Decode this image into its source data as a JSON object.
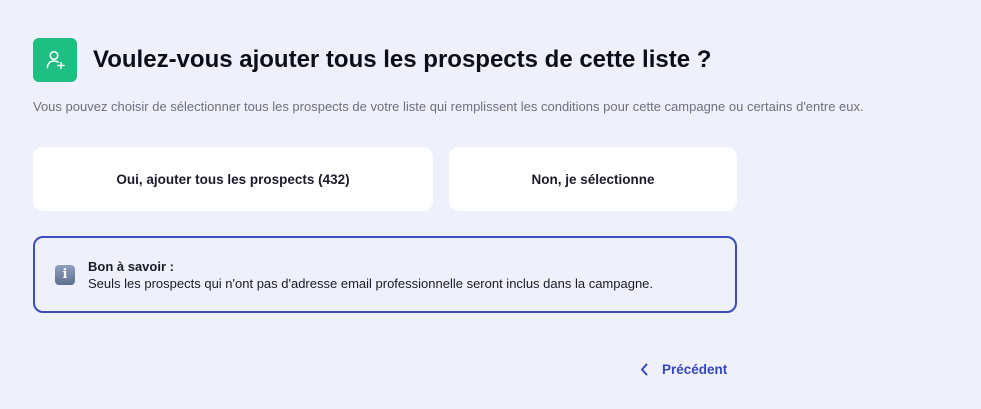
{
  "header": {
    "icon": "user-add-icon",
    "icon_bg": "#1fbf84",
    "title": "Voulez-vous ajouter tous les prospects de cette liste ?"
  },
  "subtitle": "Vous pouvez choisir de sélectionner tous les prospects de votre liste qui remplissent les conditions pour cette campagne ou certains d'entre eux.",
  "choices": {
    "all_label": "Oui, ajouter tous les prospects (432)",
    "select_label": "Non, je sélectionne"
  },
  "info": {
    "icon": "info-icon",
    "title": "Bon à savoir :",
    "text": "Seuls les prospects qui n'ont pas d'adresse email professionnelle seront inclus dans la campagne.",
    "border_color": "#3a4dbf"
  },
  "nav": {
    "prev_icon": "chevron-left-icon",
    "prev_label": "Précédent",
    "accent": "#3548c0"
  }
}
